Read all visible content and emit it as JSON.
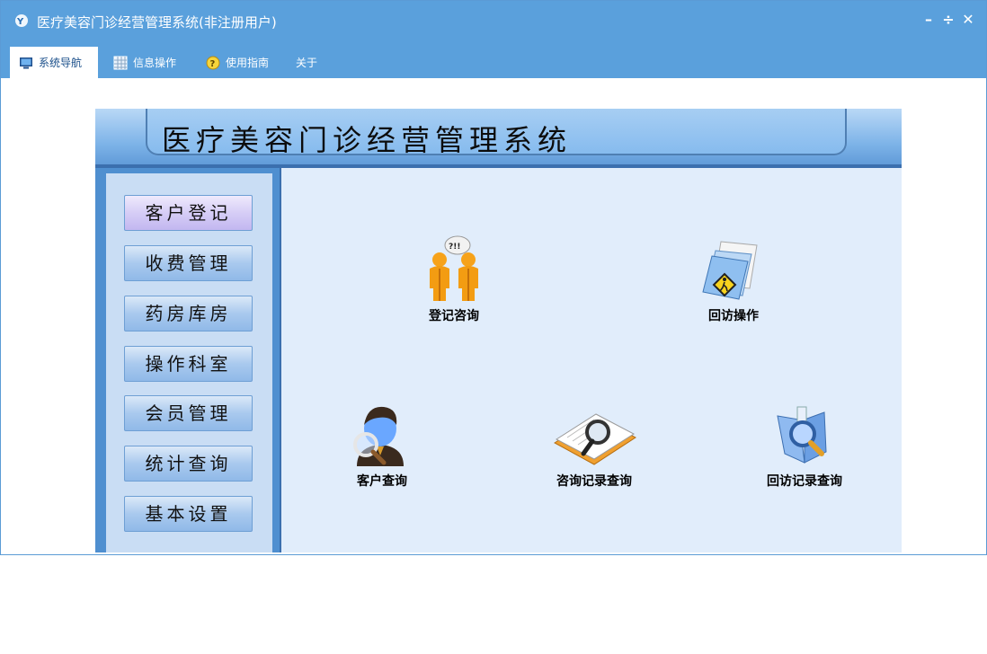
{
  "window": {
    "title": "医疗美容门诊经营管理系统(非注册用户)",
    "minimize": "–",
    "restore": "÷",
    "close": "✕"
  },
  "menu": [
    {
      "label": "系统导航",
      "icon": "monitor-icon",
      "active": true
    },
    {
      "label": "信息操作",
      "icon": "grid-icon",
      "active": false
    },
    {
      "label": "使用指南",
      "icon": "help-icon",
      "active": false
    },
    {
      "label": "关于",
      "icon": "",
      "active": false
    }
  ],
  "banner": {
    "title": "医疗美容门诊经营管理系统"
  },
  "sidebar": {
    "items": [
      {
        "label": "客户登记",
        "active": true
      },
      {
        "label": "收费管理",
        "active": false
      },
      {
        "label": "药房库房",
        "active": false
      },
      {
        "label": "操作科室",
        "active": false
      },
      {
        "label": "会员管理",
        "active": false
      },
      {
        "label": "统计查询",
        "active": false
      },
      {
        "label": "基本设置",
        "active": false
      }
    ]
  },
  "functions": [
    {
      "label": "登记咨询",
      "icon": "consult-people-icon"
    },
    {
      "label": "回访操作",
      "icon": "folder-walk-icon"
    },
    {
      "label": "客户查询",
      "icon": "user-search-icon"
    },
    {
      "label": "咨询记录查询",
      "icon": "book-search-icon"
    },
    {
      "label": "回访记录查询",
      "icon": "blue-search-icon"
    }
  ],
  "colors": {
    "titlebar": "#5aa0dc",
    "active_button": "#d6cdf6",
    "panel_bg": "#e1edfb"
  }
}
